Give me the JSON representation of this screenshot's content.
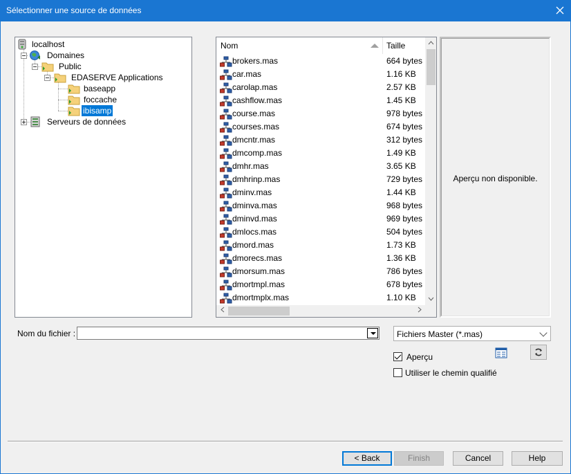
{
  "window": {
    "title": "Sélectionner une source de données"
  },
  "tree": {
    "nodes": [
      {
        "label": "localhost",
        "icon": "server-icon"
      },
      {
        "label": "Domaines",
        "icon": "globe-icon"
      },
      {
        "label": "Public",
        "icon": "folder-icon"
      },
      {
        "label": "EDASERVE Applications",
        "icon": "folder-icon"
      },
      {
        "label": "baseapp",
        "icon": "folder-icon"
      },
      {
        "label": "foccache",
        "icon": "folder-icon"
      },
      {
        "label": "ibisamp",
        "icon": "folder-open-icon",
        "selected": true
      },
      {
        "label": "Serveurs de données",
        "icon": "database-server-icon"
      }
    ]
  },
  "filelist": {
    "col_name": "Nom",
    "col_size": "Taille",
    "rows": [
      {
        "name": "brokers.mas",
        "size": "664 bytes"
      },
      {
        "name": "car.mas",
        "size": "1.16 KB"
      },
      {
        "name": "carolap.mas",
        "size": "2.57 KB"
      },
      {
        "name": "cashflow.mas",
        "size": "1.45 KB"
      },
      {
        "name": "course.mas",
        "size": "978 bytes"
      },
      {
        "name": "courses.mas",
        "size": "674 bytes"
      },
      {
        "name": "dmcntr.mas",
        "size": "312 bytes"
      },
      {
        "name": "dmcomp.mas",
        "size": "1.49 KB"
      },
      {
        "name": "dmhr.mas",
        "size": "3.65 KB"
      },
      {
        "name": "dmhrinp.mas",
        "size": "729 bytes"
      },
      {
        "name": "dminv.mas",
        "size": "1.44 KB"
      },
      {
        "name": "dminva.mas",
        "size": "968 bytes"
      },
      {
        "name": "dminvd.mas",
        "size": "969 bytes"
      },
      {
        "name": "dmlocs.mas",
        "size": "504 bytes"
      },
      {
        "name": "dmord.mas",
        "size": "1.73 KB"
      },
      {
        "name": "dmorecs.mas",
        "size": "1.36 KB"
      },
      {
        "name": "dmorsum.mas",
        "size": "786 bytes"
      },
      {
        "name": "dmortmpl.mas",
        "size": "678 bytes"
      },
      {
        "name": "dmortmplx.mas",
        "size": "1.10 KB"
      }
    ]
  },
  "preview": {
    "text": "Aperçu non disponible."
  },
  "form": {
    "filename_label": "Nom du fichier :",
    "filename_value": "",
    "filter_value": "Fichiers Master (*.mas)",
    "preview_label": "Aperçu",
    "preview_checked": true,
    "qualified_label": "Utiliser le chemin qualifié",
    "qualified_checked": false
  },
  "buttons": {
    "back": "< Back",
    "finish": "Finish",
    "cancel": "Cancel",
    "help": "Help"
  },
  "colors": {
    "titlebar": "#1a76d2",
    "selection": "#0078d7"
  }
}
